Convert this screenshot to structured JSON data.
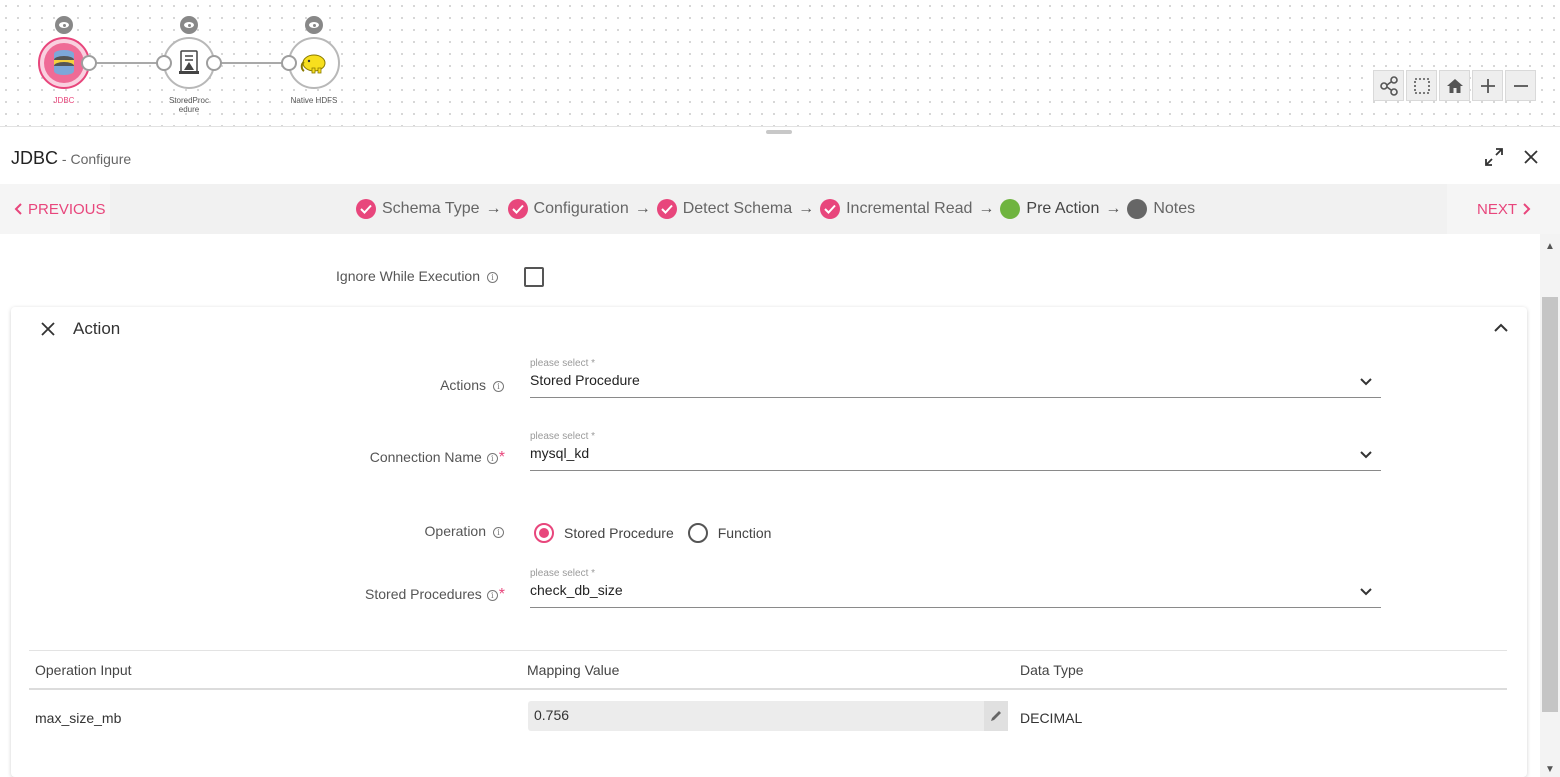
{
  "pipeline": {
    "nodes": [
      {
        "label": "JDBC"
      },
      {
        "label": "StoredProc\nedure"
      },
      {
        "label": "Native HDFS"
      }
    ]
  },
  "panel": {
    "title": "JDBC",
    "subtitle": " - Configure"
  },
  "wizard": {
    "prev_label": "PREVIOUS",
    "next_label": "NEXT",
    "steps": [
      {
        "label": "Schema Type",
        "state": "done"
      },
      {
        "label": "Configuration",
        "state": "done"
      },
      {
        "label": "Detect Schema",
        "state": "done"
      },
      {
        "label": "Incremental Read",
        "state": "done"
      },
      {
        "label": "Pre Action",
        "state": "current"
      },
      {
        "label": "Notes",
        "state": "pending"
      }
    ],
    "arrow": "→"
  },
  "form": {
    "ignore_label": "Ignore While Execution",
    "ignore_checked": false,
    "action_title": "Action",
    "actions": {
      "label": "Actions",
      "placeholder": "please select *",
      "value": "Stored Procedure"
    },
    "connection": {
      "label": "Connection Name",
      "required_mark": "*",
      "placeholder": "please select *",
      "value": "mysql_kd"
    },
    "operation": {
      "label": "Operation",
      "options": [
        "Stored Procedure",
        "Function"
      ],
      "selected": "Stored Procedure"
    },
    "procedures": {
      "label": "Stored Procedures",
      "required_mark": "*",
      "placeholder": "please select *",
      "value": "check_db_size"
    }
  },
  "table": {
    "headers": [
      "Operation Input",
      "Mapping Value",
      "Data Type"
    ],
    "rows": [
      {
        "input": "max_size_mb",
        "mapping": "0.756",
        "type": "DECIMAL"
      }
    ]
  },
  "colors": {
    "accent": "#e8467c",
    "current_step": "#6fb43f",
    "pending_step": "#666666"
  }
}
